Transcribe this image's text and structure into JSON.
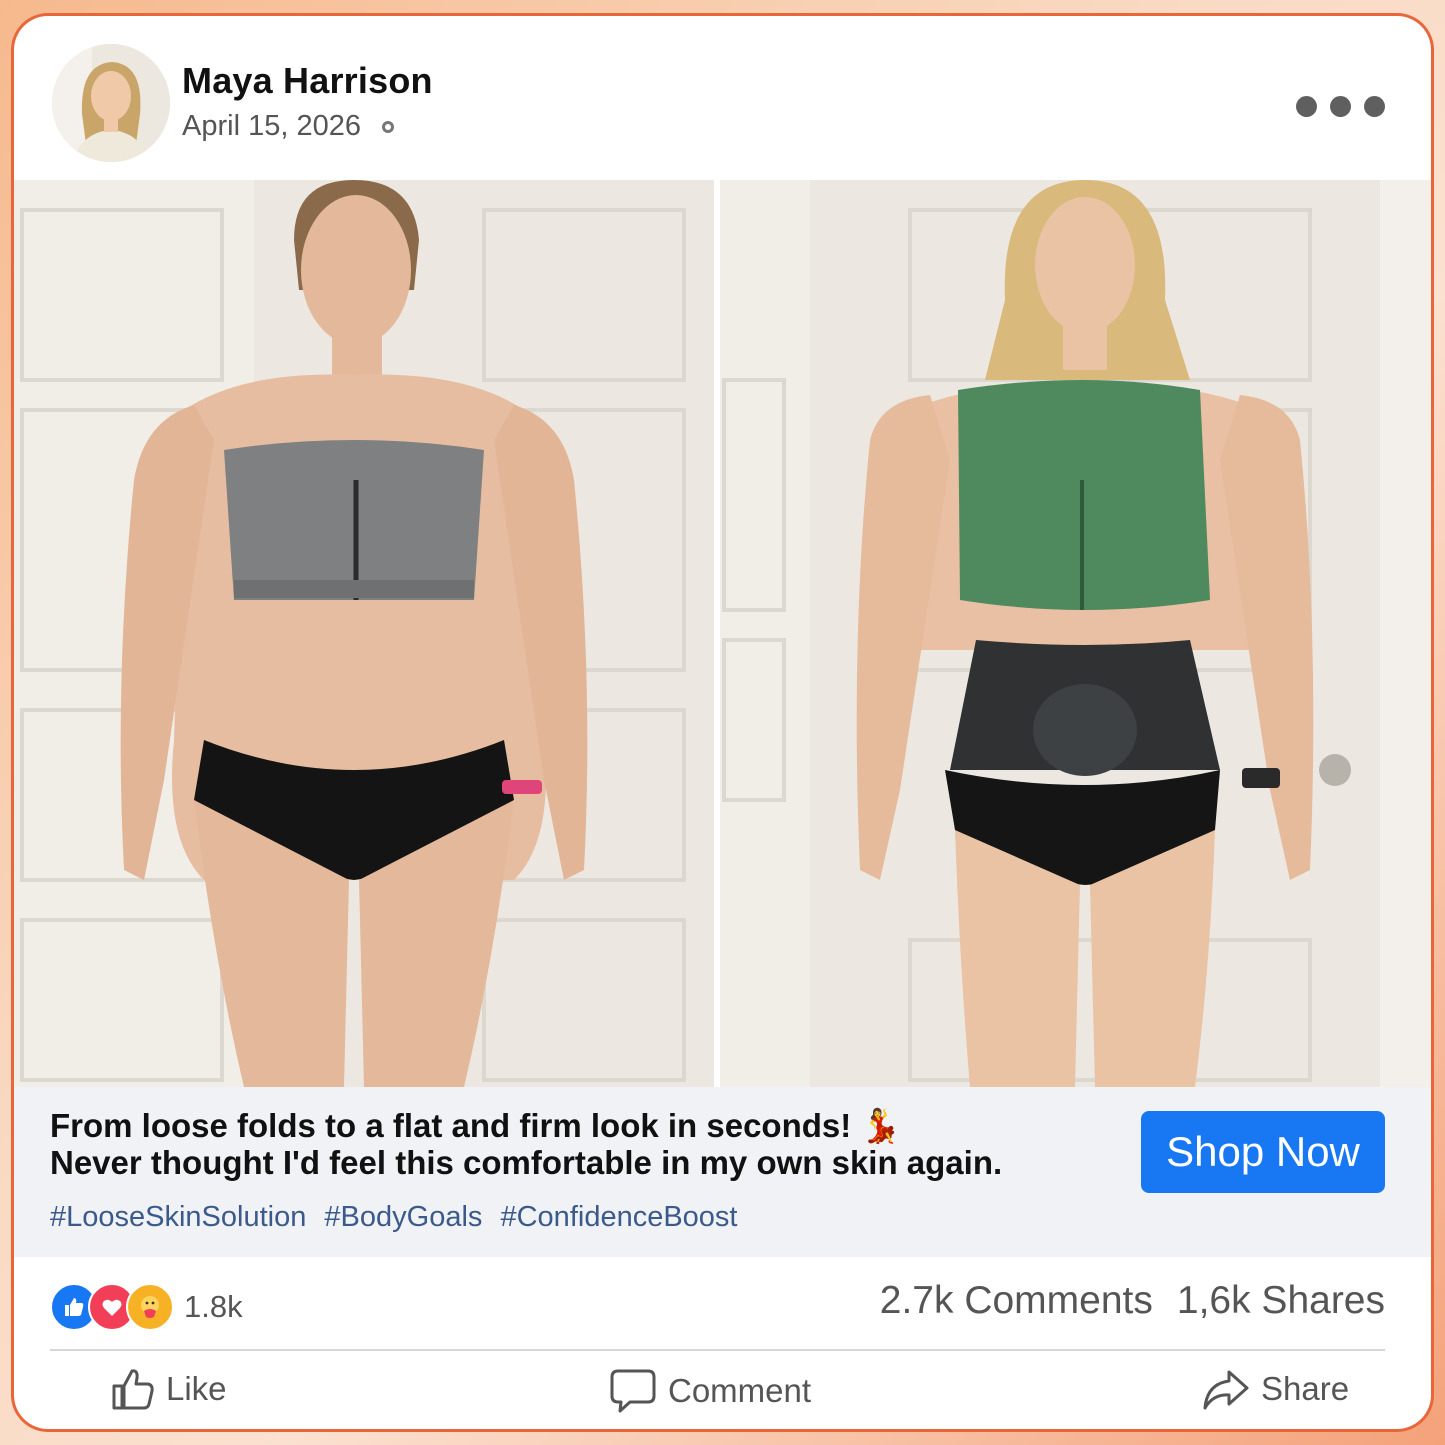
{
  "post": {
    "author": "Maya Harrison",
    "date": "April 15, 2026",
    "caption_line1": "From loose folds to a flat and firm look in seconds! 💃",
    "caption_line2": "Never thought I'd feel this comfortable in my own skin again.",
    "hashtags": [
      "#LooseSkinSolution",
      "#BodyGoals",
      "#ConfidenceBoost"
    ],
    "cta_label": "Shop Now"
  },
  "stats": {
    "reaction_icons": [
      "like-icon",
      "love-icon",
      "care-icon"
    ],
    "reactions_count": "1.8k",
    "comments": "2.7k Comments",
    "shares": "1,6k Shares"
  },
  "actions": {
    "like": "Like",
    "comment": "Comment",
    "share": "Share"
  },
  "colors": {
    "accent": "#1877f2",
    "hashtag": "#3b5a8c",
    "frame": "#e8663a"
  }
}
